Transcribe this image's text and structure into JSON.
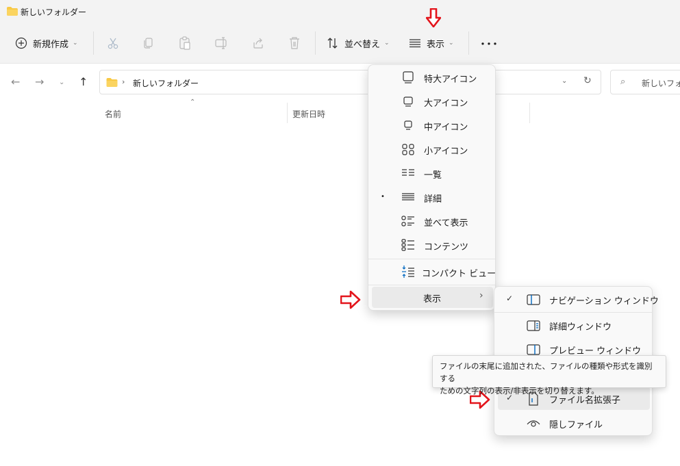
{
  "window": {
    "title": "新しいフォルダー"
  },
  "toolbar": {
    "new_label": "新規作成",
    "sort_label": "並べ替え",
    "view_label": "表示",
    "more_label": "･･･"
  },
  "address": {
    "crumb": "新しいフォルダー",
    "search_placeholder": "新しいフォルダ"
  },
  "columns": {
    "name": "名前",
    "modified": "更新日時"
  },
  "view_menu": {
    "items": [
      {
        "label": "特大アイコン",
        "icon": "extra-large-icons-icon"
      },
      {
        "label": "大アイコン",
        "icon": "large-icons-icon"
      },
      {
        "label": "中アイコン",
        "icon": "medium-icons-icon"
      },
      {
        "label": "小アイコン",
        "icon": "small-icons-icon"
      },
      {
        "label": "一覧",
        "icon": "list-icon"
      },
      {
        "label": "詳細",
        "icon": "details-icon",
        "selected": true
      },
      {
        "label": "並べて表示",
        "icon": "tiles-icon"
      },
      {
        "label": "コンテンツ",
        "icon": "content-icon"
      }
    ],
    "compact_label": "コンパクト ビュー",
    "show_label": "表示",
    "selected_bullet": "•"
  },
  "show_submenu": {
    "items": [
      {
        "label": "ナビゲーション ウィンドウ",
        "checked": true,
        "icon": "navigation-pane-icon"
      },
      {
        "label": "詳細ウィンドウ",
        "checked": false,
        "icon": "details-pane-icon"
      },
      {
        "label": "プレビュー ウィンドウ",
        "checked": false,
        "icon": "preview-pane-icon"
      },
      {
        "label": "ファイル名拡張子",
        "checked": true,
        "icon": "file-extension-icon"
      },
      {
        "label": "隠しファイル",
        "checked": false,
        "icon": "hidden-files-icon"
      }
    ],
    "check_glyph": "✓"
  },
  "tooltip": {
    "line1": "ファイルの末尾に追加された、ファイルの種類や形式を識別する",
    "line2": "ための文字列の表示/非表示を切り替えます。"
  },
  "colors": {
    "accent": "#0067c0",
    "annotation_red": "#e3141b",
    "folder_yellow": "#f8c945"
  }
}
